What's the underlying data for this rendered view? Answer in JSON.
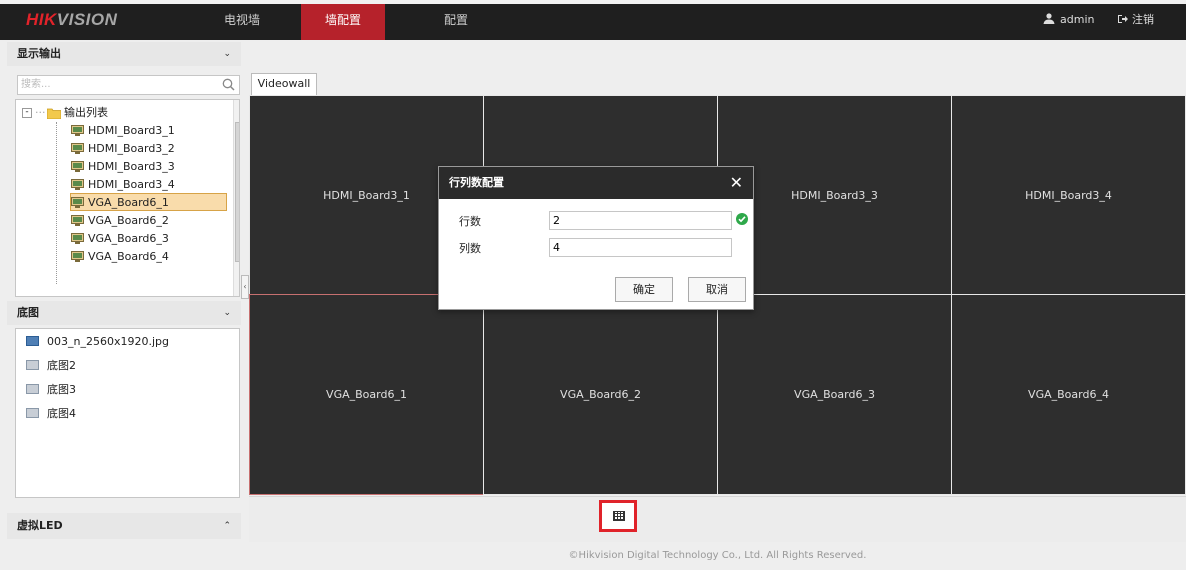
{
  "header": {
    "logo_red": "HIK",
    "logo_grey": "VISION",
    "tabs": [
      {
        "label": "电视墙"
      },
      {
        "label": "墙配置"
      },
      {
        "label": "配置"
      }
    ],
    "user": "admin",
    "logout": "注销"
  },
  "sidebar": {
    "display_output": {
      "title": "显示输出",
      "search_placeholder": "搜索...",
      "root": "输出列表",
      "items": [
        "HDMI_Board3_1",
        "HDMI_Board3_2",
        "HDMI_Board3_3",
        "HDMI_Board3_4",
        "VGA_Board6_1",
        "VGA_Board6_2",
        "VGA_Board6_3",
        "VGA_Board6_4"
      ]
    },
    "base_map": {
      "title": "底图",
      "items": [
        "003_n_2560x1920.jpg",
        "底图2",
        "底图3",
        "底图4"
      ]
    },
    "virtual_led": {
      "title": "虚拟LED"
    }
  },
  "main": {
    "tab": "Videowall",
    "cells": [
      "HDMI_Board3_1",
      "",
      "HDMI_Board3_3",
      "HDMI_Board3_4",
      "VGA_Board6_1",
      "VGA_Board6_2",
      "VGA_Board6_3",
      "VGA_Board6_4"
    ]
  },
  "dialog": {
    "title": "行列数配置",
    "close": "✕",
    "rows_label": "行数",
    "rows_value": "2",
    "cols_label": "列数",
    "cols_value": "4",
    "ok": "确定",
    "cancel": "取消"
  },
  "footer": "©Hikvision Digital Technology Co., Ltd. All Rights Reserved."
}
